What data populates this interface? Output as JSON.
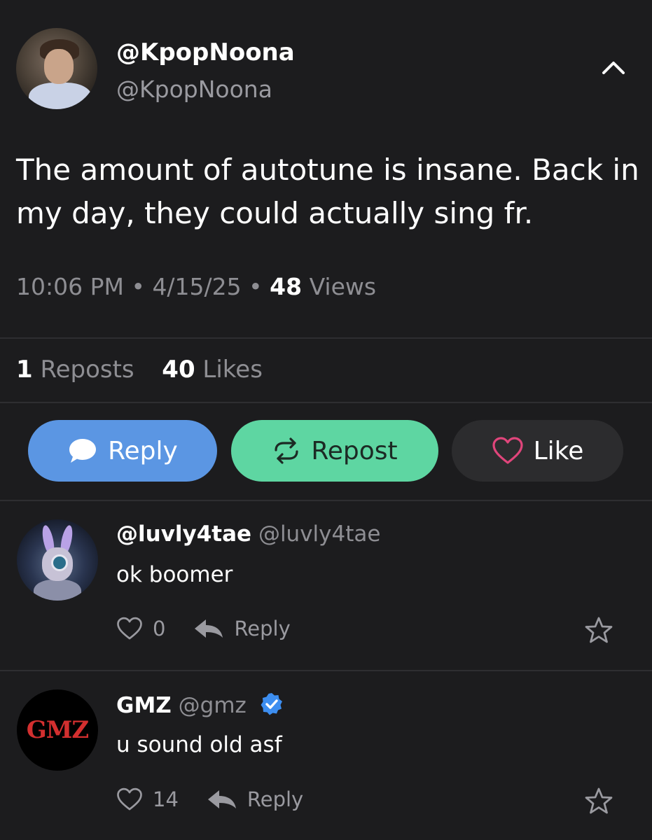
{
  "post": {
    "display_name": "@KpopNoona",
    "handle": "@KpopNoona",
    "text": "The amount of autotune is insane. Back in my day, they could actually sing fr.",
    "time": "10:06 PM",
    "date": "4/15/25",
    "views_count": "48",
    "views_label": "Views",
    "reposts_count": "1",
    "reposts_label": "Reposts",
    "likes_count": "40",
    "likes_label": "Likes"
  },
  "actions": {
    "reply_label": "Reply",
    "repost_label": "Repost",
    "like_label": "Like"
  },
  "comments": [
    {
      "name": "@luvly4tae",
      "handle": "@luvly4tae",
      "text": "ok boomer",
      "likes": "0",
      "reply_label": "Reply"
    },
    {
      "name": "GMZ",
      "handle": "@gmz",
      "text": "u sound old asf",
      "likes": "14",
      "reply_label": "Reply",
      "avatar_text": "GMZ"
    }
  ],
  "colors": {
    "background": "#1c1c1e",
    "reply_button": "#5b96e3",
    "repost_button": "#5ed6a2",
    "like_button": "#2c2c2e",
    "like_heart": "#e0457b",
    "verified": "#3d8ef0"
  },
  "icons": [
    "chevron-up-icon",
    "speech-bubble-icon",
    "repost-arrows-icon",
    "heart-icon",
    "reply-arrow-icon",
    "star-icon",
    "verified-badge-icon"
  ]
}
